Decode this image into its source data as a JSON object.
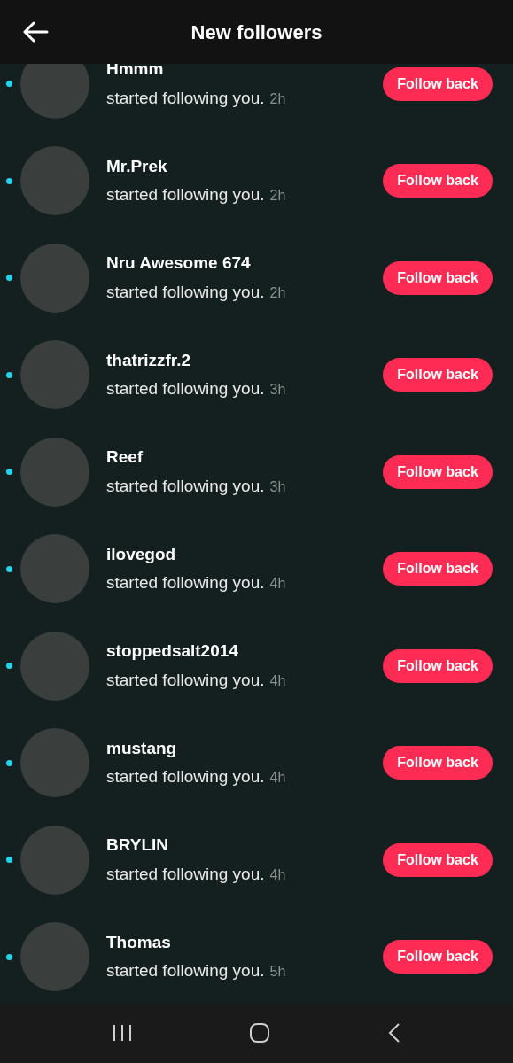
{
  "header": {
    "title": "New followers"
  },
  "followers": [
    {
      "name": "Hmmm",
      "text": "started following you.",
      "time": "2h",
      "unread": true,
      "button": "Follow back"
    },
    {
      "name": "Mr.Prek",
      "text": "started following you.",
      "time": "2h",
      "unread": true,
      "button": "Follow back"
    },
    {
      "name": "Nru Awesome 674",
      "text": "started following you.",
      "time": "2h",
      "unread": true,
      "button": "Follow back"
    },
    {
      "name": "thatrizzfr.2",
      "text": "started following you.",
      "time": "3h",
      "unread": true,
      "button": "Follow back"
    },
    {
      "name": "Reef",
      "text": "started following you.",
      "time": "3h",
      "unread": true,
      "button": "Follow back"
    },
    {
      "name": "ilovegod",
      "text": "started following you.",
      "time": "4h",
      "unread": true,
      "button": "Follow back"
    },
    {
      "name": "stoppedsalt2014",
      "text": "started following you.",
      "time": "4h",
      "unread": true,
      "button": "Follow back"
    },
    {
      "name": "mustang",
      "text": "started following you.",
      "time": "4h",
      "unread": true,
      "button": "Follow back"
    },
    {
      "name": "BRYLIN",
      "text": "started following you.",
      "time": "4h",
      "unread": true,
      "button": "Follow back"
    },
    {
      "name": "Thomas",
      "text": "started following you.",
      "time": "5h",
      "unread": true,
      "button": "Follow back"
    }
  ]
}
